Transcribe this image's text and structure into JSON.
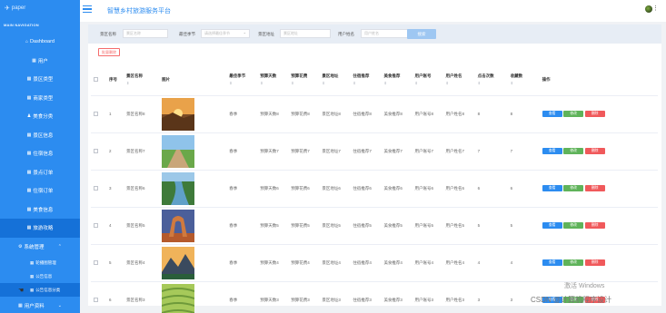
{
  "app": {
    "logo_text": "paper",
    "title": "智慧乡村旅游服务平台"
  },
  "sidebar": {
    "nav_title": "MAIN NAVIGATION",
    "items": [
      {
        "label": "Dashboard",
        "icon": "home-icon"
      },
      {
        "label": "用户",
        "icon": "grid-icon"
      },
      {
        "label": "景区类型",
        "icon": "grid-icon"
      },
      {
        "label": "商家类型",
        "icon": "grid-icon"
      },
      {
        "label": "美食分类",
        "icon": "person-icon"
      },
      {
        "label": "景区信息",
        "icon": "grid-icon"
      },
      {
        "label": "住宿信息",
        "icon": "grid-icon"
      },
      {
        "label": "景点订单",
        "icon": "grid-icon"
      },
      {
        "label": "住宿订单",
        "icon": "grid-icon"
      },
      {
        "label": "美食信息",
        "icon": "grid-icon"
      },
      {
        "label": "旅游攻略",
        "icon": "grid-icon"
      }
    ],
    "group": {
      "label": "系统管理",
      "subitems": [
        "轮播图管理",
        "公告信息",
        "公告信息分类"
      ]
    },
    "group2": {
      "label": "用户资料"
    }
  },
  "filters": {
    "labels": [
      "景区名称",
      "最佳季节",
      "景区地址",
      "用户姓名"
    ],
    "placeholders": [
      "景区名称",
      "请选择最佳季节",
      "景区地址",
      "用户姓名"
    ],
    "search_label": "搜索",
    "bulk_delete_label": "批量删除"
  },
  "table": {
    "headers": [
      "序号",
      "景区名称",
      "图片",
      "最佳季节",
      "预算天数",
      "预算花费",
      "景区地址",
      "住宿推荐",
      "美食推荐",
      "用户账号",
      "用户姓名",
      "点击次数",
      "收藏数",
      "操作"
    ],
    "ops": {
      "view": "查看",
      "edit": "修改",
      "delete": "删除"
    },
    "rows": [
      [
        "1",
        "景区名称8",
        "sunset",
        "春季",
        "预算天数8",
        "预算花费8",
        "景区地址8",
        "住宿推荐8",
        "美食推荐8",
        "用户账号8",
        "用户姓名8",
        "8",
        "8"
      ],
      [
        "2",
        "景区名称7",
        "road",
        "春季",
        "预算天数7",
        "预算花费7",
        "景区地址7",
        "住宿推荐7",
        "美食推荐7",
        "用户账号7",
        "用户姓名7",
        "7",
        "7"
      ],
      [
        "3",
        "景区名称6",
        "river",
        "春季",
        "预算天数6",
        "预算花费6",
        "景区地址6",
        "住宿推荐6",
        "美食推荐6",
        "用户账号6",
        "用户姓名6",
        "6",
        "6"
      ],
      [
        "4",
        "景区名称5",
        "arch",
        "春季",
        "预算天数5",
        "预算花费5",
        "景区地址5",
        "住宿推荐5",
        "美食推荐5",
        "用户账号5",
        "用户姓名5",
        "5",
        "5"
      ],
      [
        "5",
        "景区名称4",
        "mountain",
        "春季",
        "预算天数4",
        "预算花费4",
        "景区地址4",
        "住宿推荐4",
        "美食推荐4",
        "用户账号4",
        "用户姓名4",
        "4",
        "4"
      ],
      [
        "6",
        "景区名称3",
        "terrace",
        "春季",
        "预算天数3",
        "预算花费3",
        "景区地址3",
        "住宿推荐3",
        "美食推荐3",
        "用户账号3",
        "用户姓名3",
        "3",
        "3"
      ]
    ]
  },
  "watermark": {
    "activate": "激活 Windows",
    "csdn": "CSDN @计算机程序设计"
  }
}
